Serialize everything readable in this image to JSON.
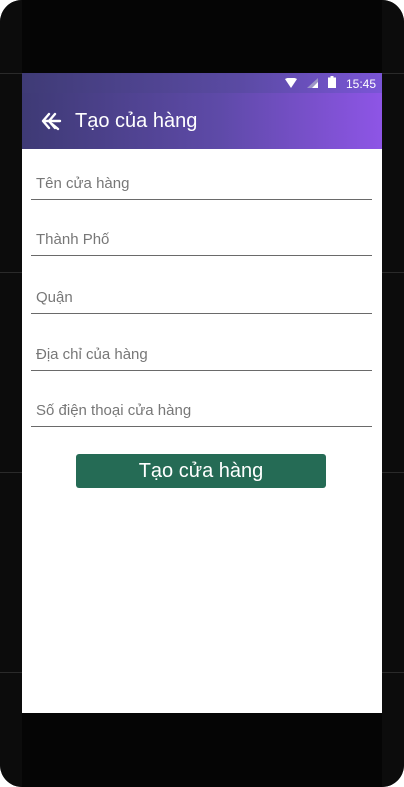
{
  "status_bar": {
    "time": "15:45",
    "icons": [
      "wifi-icon",
      "cell-signal-icon",
      "battery-icon"
    ]
  },
  "app_bar": {
    "title": "Tạo của hàng",
    "back_icon": "back-arrow-icon"
  },
  "form": {
    "fields": [
      {
        "placeholder": "Tên cửa hàng",
        "value": ""
      },
      {
        "placeholder": "Thành Phố",
        "value": ""
      },
      {
        "placeholder": "Quận",
        "value": ""
      },
      {
        "placeholder": "Địa chỉ của hàng",
        "value": ""
      },
      {
        "placeholder": "Số điện thoại cửa hàng",
        "value": ""
      }
    ],
    "submit_label": "Tạo cửa hàng"
  },
  "colors": {
    "appbar_start": "#3e3a75",
    "appbar_end": "#8e55e6",
    "button": "#256b55"
  }
}
